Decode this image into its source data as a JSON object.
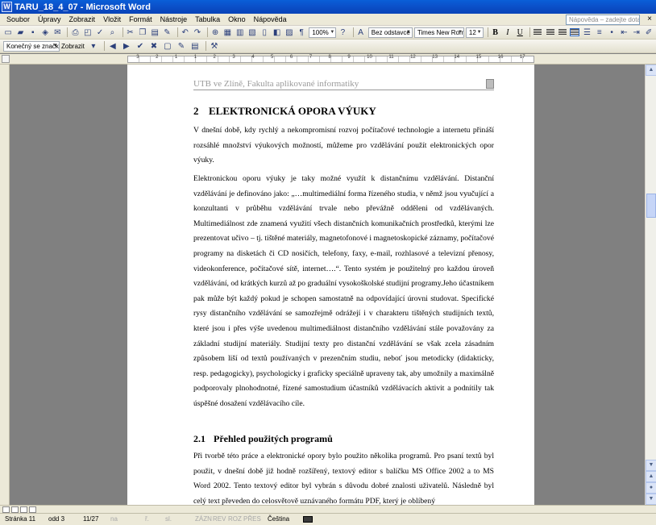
{
  "window": {
    "title": "TARU_18_4_07 - Microsoft Word",
    "app_icon": "W"
  },
  "menubar": {
    "items": [
      "Soubor",
      "Úpravy",
      "Zobrazit",
      "Vložit",
      "Formát",
      "Nástroje",
      "Tabulka",
      "Okno",
      "Nápověda"
    ],
    "help_placeholder": "Nápověda – zadejte dotaz",
    "close_glyph": "×"
  },
  "toolbar": {
    "zoom": "100%",
    "style": "Bez odstavce",
    "font": "Times New Roman",
    "size": "12",
    "bold": "B",
    "italic": "I",
    "underline": "U",
    "markup_view": "Konečný se značkami",
    "show_menu": "Zobrazit"
  },
  "document": {
    "header": "UTB ve Zlíně, Fakulta aplikované informatiky",
    "heading1": {
      "number": "2",
      "text": "ELEKTRONICKÁ OPORA VÝUKY"
    },
    "paragraph1": "V dnešní době, kdy rychlý a nekompromisní rozvoj počítačové technologie a internetu přináší rozsáhlé množství výukových možností, můžeme pro vzdělávání použít elektronických opor výuky.",
    "paragraph2": "Elektronickou oporu výuky je taky možné využít k distančnímu vzdělávání. Distanční vzdělávání je definováno jako: „…multimediální forma řízeného studia, v němž jsou vyučující a konzultanti v průběhu vzdělávání trvale nebo převážně odděleni od vzdělávaných. Multimediálnost zde znamená využití všech distančních komunikačních prostředků, kterými lze prezentovat učivo – tj. tištěné materiály, magnetofonové i magnetoskopické záznamy, počítačové programy na disketách či CD nosičích, telefony, faxy, e-mail, rozhlasové a televizní přenosy, videokonference, počítačové sítě, internet….“. Tento systém je použitelný pro každou úroveň vzdělávání, od krátkých kurzů až po graduální vysokoškolské studijní programy.Jeho účastníkem pak může být každý pokud je schopen samostatně na odpovídající úrovni studovat. Specifické rysy distančního vzdělávání se samozřejmě odrážejí i v charakteru tištěných studijních textů, které jsou i přes výše uvedenou multimediálnost distančního vzdělávání stále považovány za základní studijní materiály. Studijní texty pro distanční vzdělávání se však zcela zásadním způsobem liší od textů používaných v prezenčním studiu, neboť jsou metodicky (didakticky, resp. pedagogicky), psychologicky i graficky speciálně upraveny tak, aby umožnily a maximálně podporovaly plnohodnotné, řízené samostudium účastníků vzdělávacích aktivit a podnítily tak úspěšné dosažení vzdělávacího cíle.",
    "heading2": {
      "number": "2.1",
      "text": "Přehled použitých programů"
    },
    "paragraph3": "Při tvorbě této práce a elektronické opory bylo použito několika programů. Pro psaní textů byl použit, v dnešní době již hodně rozšířený, textový editor s balíčku MS Office 2002 a to MS Word 2002. Tento textový editor byl vybrán s důvodu dobré znalosti uživatelů. Následně byl celý text převeden do celosvětově uznávaného formátu PDF, který je oblíbený"
  },
  "ruler": {
    "numbers": [
      "3",
      "2",
      "1",
      "1",
      "2",
      "3",
      "4",
      "5",
      "6",
      "7",
      "8",
      "9",
      "10",
      "11",
      "12",
      "13",
      "14",
      "15",
      "16",
      "17"
    ]
  },
  "statusbar": {
    "page": "Stránka 11",
    "section": "odd 3",
    "count": "11/27",
    "at": "na",
    "line": "ř.",
    "column": "sl.",
    "rec": "ZÁZN",
    "rev": "REV",
    "ext": "ROZ",
    "ovr": "PŘES",
    "language": "Čeština"
  }
}
